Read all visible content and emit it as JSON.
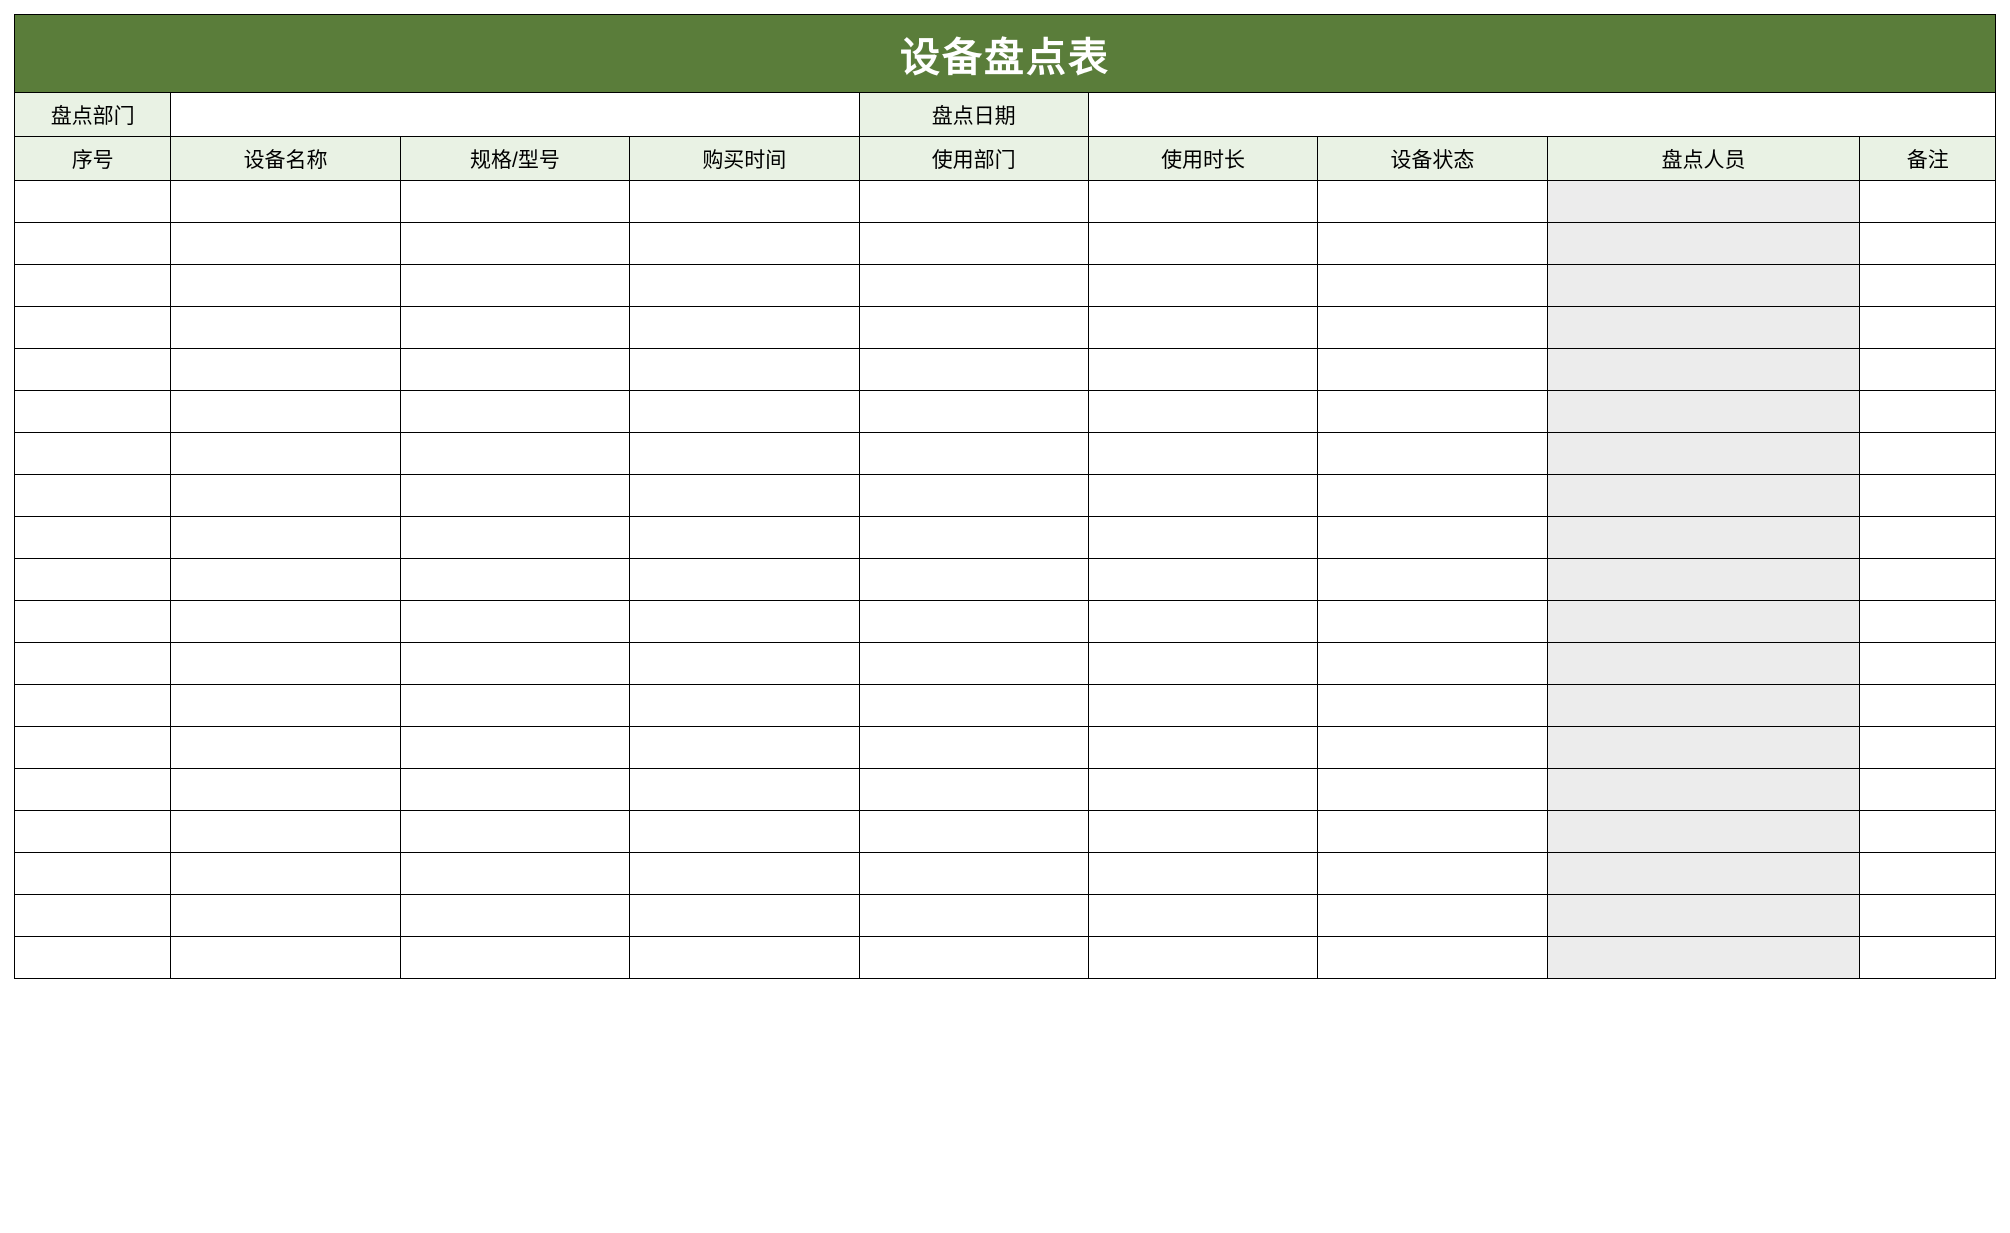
{
  "title": "设备盘点表",
  "meta": {
    "department_label": "盘点部门",
    "department_value": "",
    "date_label": "盘点日期",
    "date_value": ""
  },
  "columns": [
    "序号",
    "设备名称",
    "规格/型号",
    "购买时间",
    "使用部门",
    "使用时长",
    "设备状态",
    "盘点人员",
    "备注"
  ],
  "rows": [
    [
      "",
      "",
      "",
      "",
      "",
      "",
      "",
      "",
      ""
    ],
    [
      "",
      "",
      "",
      "",
      "",
      "",
      "",
      "",
      ""
    ],
    [
      "",
      "",
      "",
      "",
      "",
      "",
      "",
      "",
      ""
    ],
    [
      "",
      "",
      "",
      "",
      "",
      "",
      "",
      "",
      ""
    ],
    [
      "",
      "",
      "",
      "",
      "",
      "",
      "",
      "",
      ""
    ],
    [
      "",
      "",
      "",
      "",
      "",
      "",
      "",
      "",
      ""
    ],
    [
      "",
      "",
      "",
      "",
      "",
      "",
      "",
      "",
      ""
    ],
    [
      "",
      "",
      "",
      "",
      "",
      "",
      "",
      "",
      ""
    ],
    [
      "",
      "",
      "",
      "",
      "",
      "",
      "",
      "",
      ""
    ],
    [
      "",
      "",
      "",
      "",
      "",
      "",
      "",
      "",
      ""
    ],
    [
      "",
      "",
      "",
      "",
      "",
      "",
      "",
      "",
      ""
    ],
    [
      "",
      "",
      "",
      "",
      "",
      "",
      "",
      "",
      ""
    ],
    [
      "",
      "",
      "",
      "",
      "",
      "",
      "",
      "",
      ""
    ],
    [
      "",
      "",
      "",
      "",
      "",
      "",
      "",
      "",
      ""
    ],
    [
      "",
      "",
      "",
      "",
      "",
      "",
      "",
      "",
      ""
    ],
    [
      "",
      "",
      "",
      "",
      "",
      "",
      "",
      "",
      ""
    ],
    [
      "",
      "",
      "",
      "",
      "",
      "",
      "",
      "",
      ""
    ],
    [
      "",
      "",
      "",
      "",
      "",
      "",
      "",
      "",
      ""
    ],
    [
      "",
      "",
      "",
      "",
      "",
      "",
      "",
      "",
      ""
    ]
  ],
  "shaded_column_index": 7
}
